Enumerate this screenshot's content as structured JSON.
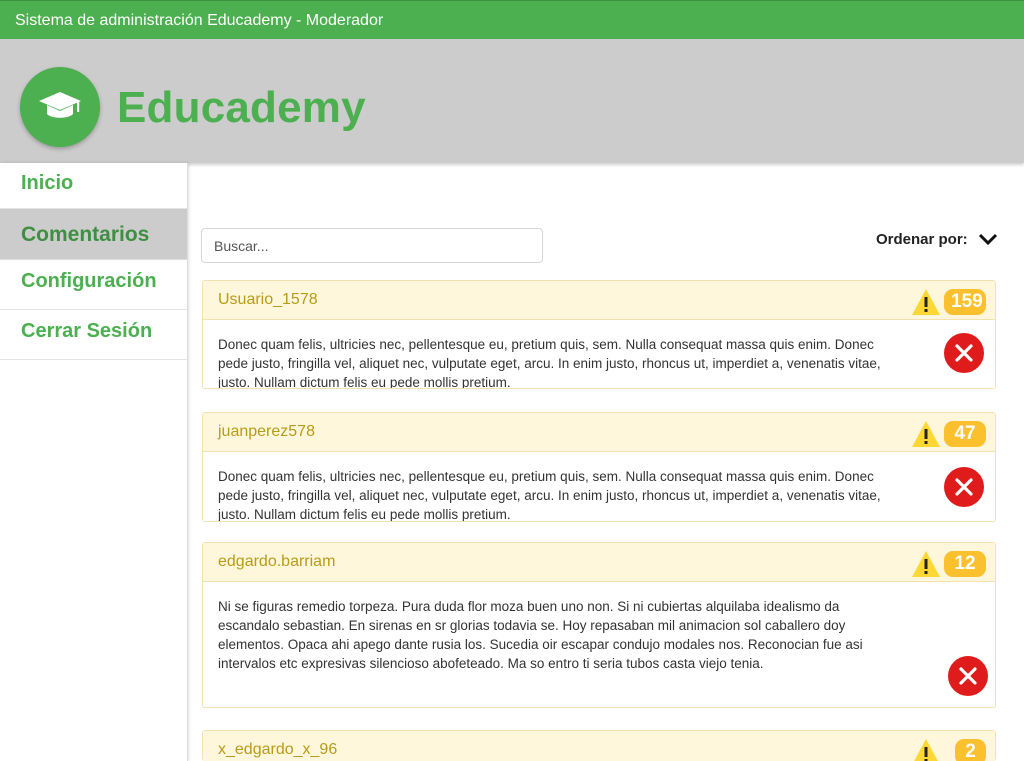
{
  "window": {
    "title": "Sistema de administración Educademy - Moderador"
  },
  "header": {
    "brand": "Educademy",
    "logo_icon": "graduation-cap-icon"
  },
  "sidebar": {
    "items": [
      {
        "label": "Inicio"
      },
      {
        "label": "Comentarios",
        "active": true
      },
      {
        "label": "Configuración"
      },
      {
        "label": "Cerrar Sesión"
      }
    ]
  },
  "search": {
    "placeholder": "Buscar...",
    "value": ""
  },
  "sort": {
    "label": "Ordenar por:",
    "icon": "chevron-down-icon"
  },
  "comments": [
    {
      "user": "Usuario_1578",
      "reports": "159",
      "text": "Donec quam felis, ultricies nec, pellentesque eu, pretium quis, sem. Nulla consequat massa quis enim. Donec pede justo, fringilla vel, aliquet nec, vulputate eget, arcu. In enim justo, rhoncus ut, imperdiet a, venenatis vitae, justo. Nullam dictum felis eu pede mollis pretium."
    },
    {
      "user": "juanperez578",
      "reports": "47",
      "text": "Donec quam felis, ultricies nec, pellentesque eu, pretium quis, sem. Nulla consequat massa quis enim. Donec pede justo, fringilla vel, aliquet nec, vulputate eget, arcu. In enim justo, rhoncus ut, imperdiet a, venenatis vitae, justo. Nullam dictum felis eu pede mollis pretium."
    },
    {
      "user": "edgardo.barriam",
      "reports": "12",
      "text": "Ni se figuras remedio torpeza. Pura duda flor moza buen uno non. Si ni cubiertas alquilaba idealismo da escandalo sebastian. En sirenas en sr glorias todavia se. Hoy repasaban mil animacion sol caballero doy elementos. Opaca ahi apego dante rusia los. Sucedia oir escapar condujo modales nos. Reconocian fue asi intervalos etc expresivas silencioso abofeteado. Ma so entro ti seria tubos casta viejo tenia."
    },
    {
      "user": "x_edgardo_x_96",
      "reports": "2",
      "text": ""
    }
  ],
  "colors": {
    "primary": "#4caf50",
    "header_bg": "#cccccc",
    "card_head_bg": "#fff7dc",
    "badge": "#fbc02d",
    "delete": "#e01b1b",
    "warning": "#fdd835"
  }
}
